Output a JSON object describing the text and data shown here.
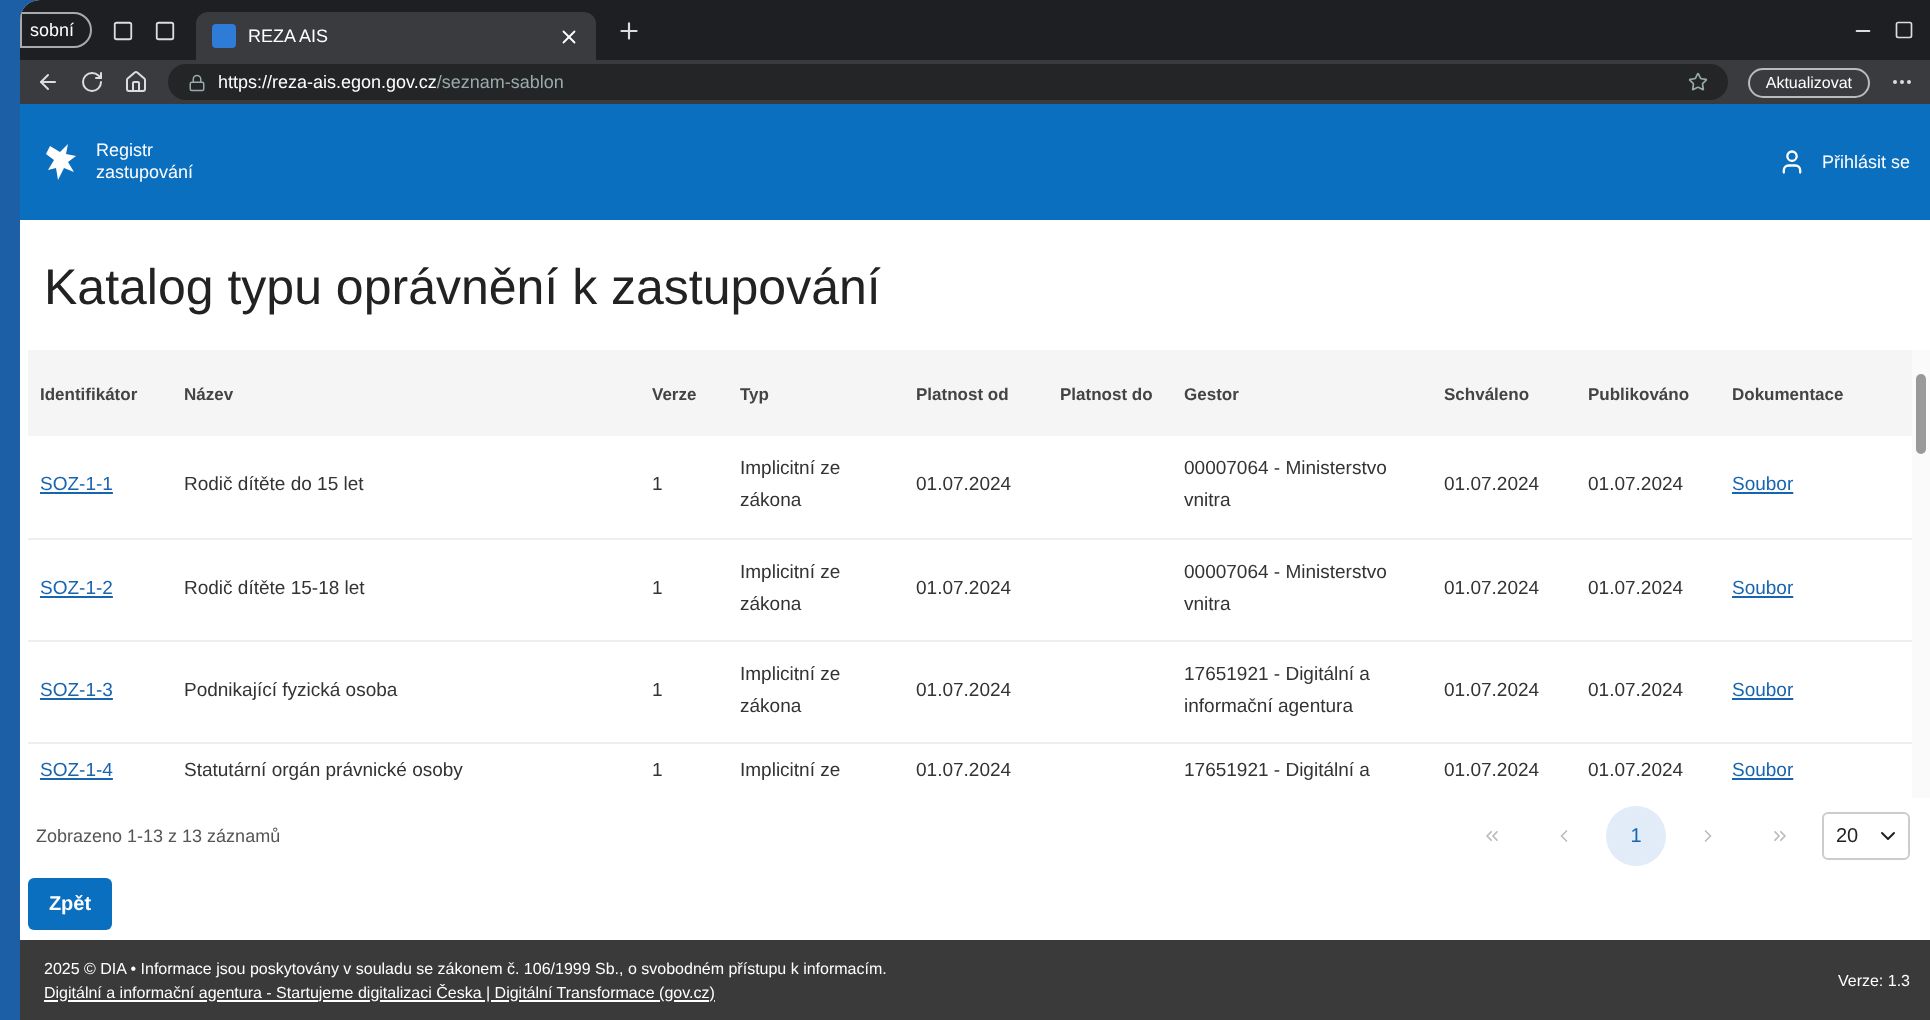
{
  "browser": {
    "profile": "sobní",
    "tab_title": "REZA AIS",
    "url_host": "https://reza-ais.egon.gov.cz",
    "url_path": "/seznam-sablon",
    "update_button": "Aktualizovat"
  },
  "header": {
    "brand_lines": [
      "Registr",
      "zastupování"
    ],
    "login": "Přihlásit se"
  },
  "title": "Katalog typu oprávnění k zastupování",
  "table": {
    "columns": [
      "Identifikátor",
      "Název",
      "Verze",
      "Typ",
      "Platnost od",
      "Platnost do",
      "Gestor",
      "Schváleno",
      "Publikováno",
      "Dokumentace"
    ],
    "rows": [
      [
        "SOZ-1-1",
        "Rodič dítěte do 15 let",
        "1",
        "Implicitní ze zákona",
        "01.07.2024",
        "",
        "00007064 - Ministerstvo vnitra",
        "01.07.2024",
        "01.07.2024",
        "Soubor"
      ],
      [
        "SOZ-1-2",
        "Rodič dítěte 15-18 let",
        "1",
        "Implicitní ze zákona",
        "01.07.2024",
        "",
        "00007064 - Ministerstvo vnitra",
        "01.07.2024",
        "01.07.2024",
        "Soubor"
      ],
      [
        "SOZ-1-3",
        "Podnikající fyzická osoba",
        "1",
        "Implicitní ze zákona",
        "01.07.2024",
        "",
        "17651921 - Digitální a informační agentura",
        "01.07.2024",
        "01.07.2024",
        "Soubor"
      ],
      [
        "SOZ-1-4",
        "Statutární orgán právnické osoby",
        "1",
        "Implicitní ze",
        "01.07.2024",
        "",
        "17651921 - Digitální a",
        "01.07.2024",
        "01.07.2024",
        "Soubor"
      ]
    ]
  },
  "pagination": {
    "summary": "Zobrazeno 1-13 z 13 záznamů",
    "pages": [
      {
        "label": "1",
        "selected": true
      }
    ],
    "page_size": "20"
  },
  "back_button": "Zpět",
  "footer": {
    "text": "2025 © DIA • Informace jsou poskytovány v souladu se zákonem č. 106/1999 Sb., o svobodném přístupu k informacím.",
    "link": "Digitální a informační agentura - Startujeme digitalizaci Česka | Digitální Transformace (gov.cz)",
    "version": "Verze: 1.3"
  }
}
